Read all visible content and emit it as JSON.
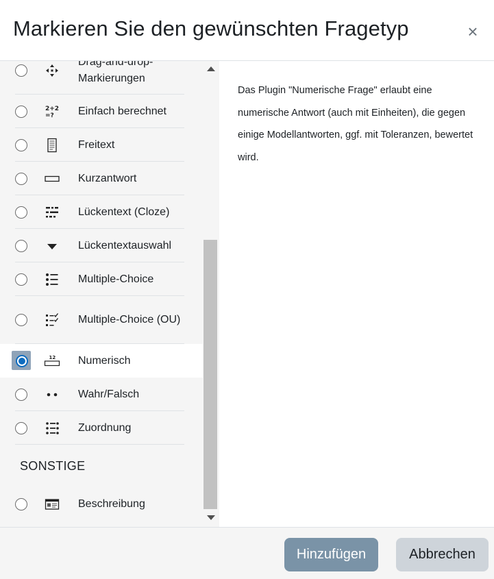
{
  "dialog": {
    "title": "Markieren Sie den gewünschten Fragetyp",
    "close_label": "×"
  },
  "question_types": [
    {
      "label": "Drag-and-drop-Markierungen",
      "icon": "move-arrows-icon",
      "selected": false
    },
    {
      "label": "Einfach berechnet",
      "icon": "calculation-icon",
      "selected": false
    },
    {
      "label": "Freitext",
      "icon": "document-icon",
      "selected": false
    },
    {
      "label": "Kurzantwort",
      "icon": "text-field-icon",
      "selected": false
    },
    {
      "label": "Lückentext (Cloze)",
      "icon": "cloze-icon",
      "selected": false
    },
    {
      "label": "Lückentextauswahl",
      "icon": "caret-down-icon",
      "selected": false
    },
    {
      "label": "Multiple-Choice",
      "icon": "list-icon",
      "selected": false
    },
    {
      "label": "Multiple-Choice (OU)",
      "icon": "checklist-icon",
      "selected": false
    },
    {
      "label": "Numerisch",
      "icon": "numeric-icon",
      "selected": true
    },
    {
      "label": "Wahr/Falsch",
      "icon": "two-dots-icon",
      "selected": false
    },
    {
      "label": "Zuordnung",
      "icon": "matching-icon",
      "selected": false
    }
  ],
  "other_section": {
    "title": "SONSTIGE",
    "items": [
      {
        "label": "Beschreibung",
        "icon": "description-icon",
        "selected": false
      }
    ]
  },
  "description": "Das Plugin \"Numerische Frage\" erlaubt eine numerische Antwort (auch mit Einheiten), die gegen einige Modellantworten, ggf. mit Toleranzen, bewertet wird.",
  "footer": {
    "add_label": "Hinzufügen",
    "cancel_label": "Abbrechen"
  },
  "colors": {
    "accent": "#0f6cbf",
    "primary_button": "#7a93a7",
    "secondary_button": "#ced4da",
    "panel_bg": "#f5f5f5"
  }
}
